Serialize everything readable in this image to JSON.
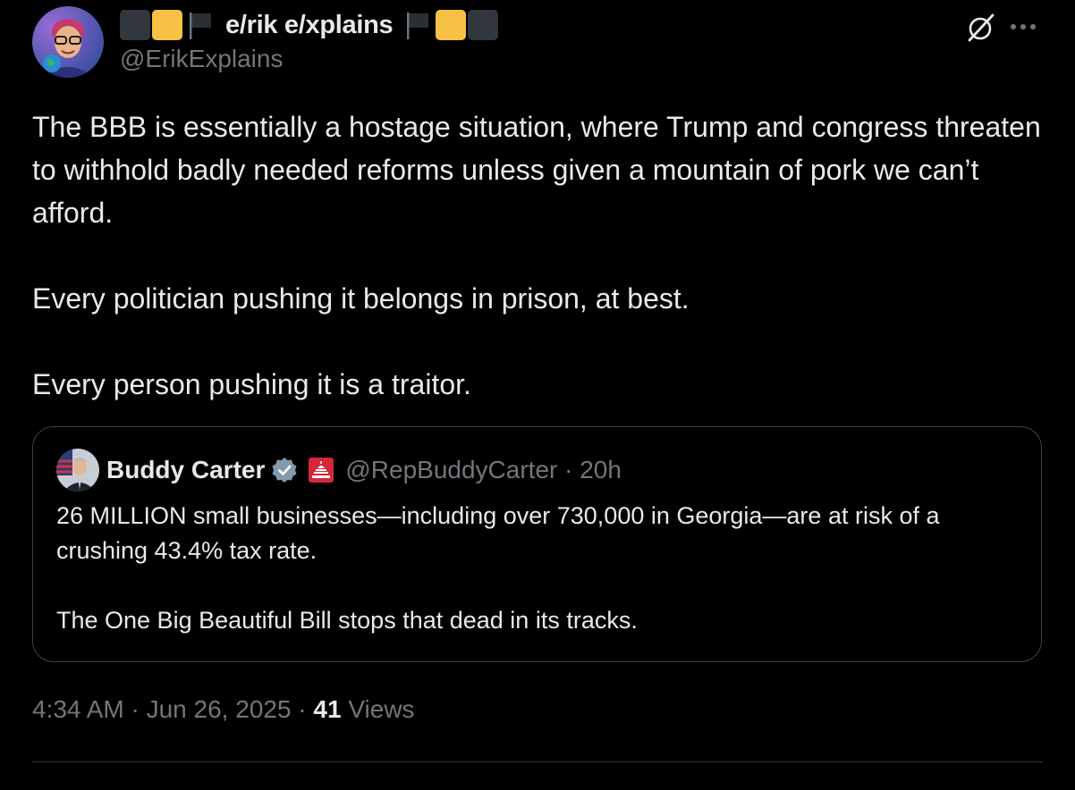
{
  "author": {
    "display_name": "e/rik e/xplains",
    "handle": "@ErikExplains",
    "avatar_icon": "avatar-cartoon-man-glasses-globe",
    "name_decorations_left": [
      "black-square",
      "yellow-square",
      "black-flag"
    ],
    "name_decorations_right": [
      "black-flag",
      "yellow-square",
      "black-square"
    ]
  },
  "actions": {
    "grok_icon": "grok-icon",
    "more_icon": "more-icon"
  },
  "tweet": {
    "paragraphs": [
      "The BBB is essentially a hostage situation, where Trump and congress threaten to withhold badly needed reforms unless given a mountain of pork we can’t afford.",
      "Every politician pushing it belongs in prison, at best.",
      "Every person pushing it is a traitor."
    ]
  },
  "quote": {
    "display_name": "Buddy Carter",
    "handle_time": "@RepBuddyCarter · 20h",
    "avatar_icon": "avatar-politician-flag",
    "paragraphs": [
      "26 MILLION small businesses—including over 730,000 in Georgia—are at risk of a crushing 43.4% tax rate.",
      "The One Big Beautiful Bill stops that dead in its tracks."
    ]
  },
  "meta": {
    "time_date": "4:34 AM · Jun 26, 2025 · ",
    "views_count": "41",
    "views_label": " Views"
  },
  "colors": {
    "background": "#000000",
    "text": "#e7e9ea",
    "muted": "#71767b",
    "border": "#3e4144",
    "yellow_square": "#f6c145",
    "black_square": "#31373d",
    "verified_gray": "#829aab",
    "capitol_red": "#d6263a"
  }
}
